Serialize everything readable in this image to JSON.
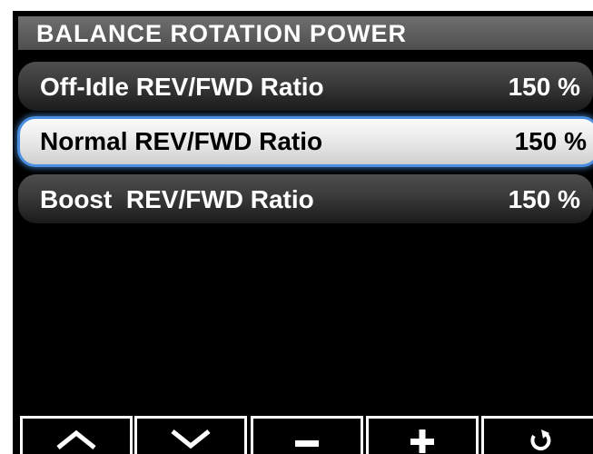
{
  "header": {
    "title": "BALANCE ROTATION POWER"
  },
  "rows": [
    {
      "label": "Off-Idle REV/FWD Ratio",
      "value": "150 %",
      "selected": false
    },
    {
      "label": "Normal REV/FWD Ratio",
      "value": "150 %",
      "selected": true
    },
    {
      "label": "Boost  REV/FWD Ratio",
      "value": "150 %",
      "selected": false
    }
  ],
  "toolbar": {
    "buttons": [
      {
        "icon": "chevron-up-icon"
      },
      {
        "icon": "chevron-down-icon"
      },
      {
        "icon": "minus-icon"
      },
      {
        "icon": "plus-icon"
      },
      {
        "icon": "undo-icon"
      }
    ]
  },
  "colors": {
    "selection_outline": "#4a8fe0",
    "background": "#000000",
    "header_background": "#5e5e5e"
  }
}
